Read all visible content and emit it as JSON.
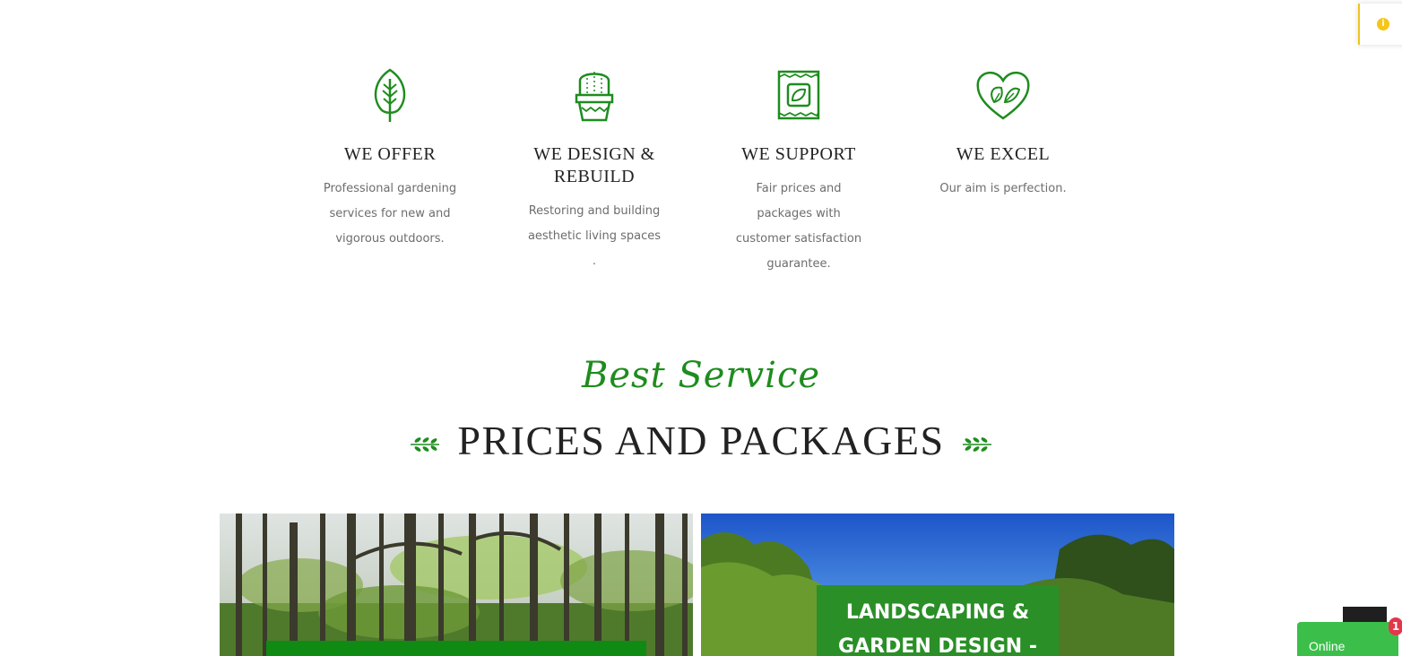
{
  "features": [
    {
      "title": "WE OFFER",
      "text": "Professional gardening services for new and vigorous outdoors.",
      "icon": "leaf-icon"
    },
    {
      "title": "WE DESIGN & REBUILD",
      "text": "Restoring and building aesthetic living spaces .",
      "icon": "cactus-pot-icon"
    },
    {
      "title": "WE SUPPORT",
      "text": "Fair prices and packages with customer satisfaction guarantee.",
      "icon": "seed-packet-icon"
    },
    {
      "title": "WE EXCEL",
      "text": "Our aim is perfection.",
      "icon": "heart-leaves-icon"
    }
  ],
  "section": {
    "script_title": "Best Service",
    "title": "PRICES AND PACKAGES"
  },
  "cards": [
    {
      "label": ""
    },
    {
      "label": "LANDSCAPING & GARDEN DESIGN -"
    }
  ],
  "widgets": {
    "notice_symbol": "i",
    "chat_label": "Online",
    "chat_badge": "1"
  },
  "colors": {
    "accent_green": "#1e8c1e",
    "card_label_green": "#2a8f27",
    "heading_dark": "#222222",
    "body_gray": "#6d6d6d"
  }
}
